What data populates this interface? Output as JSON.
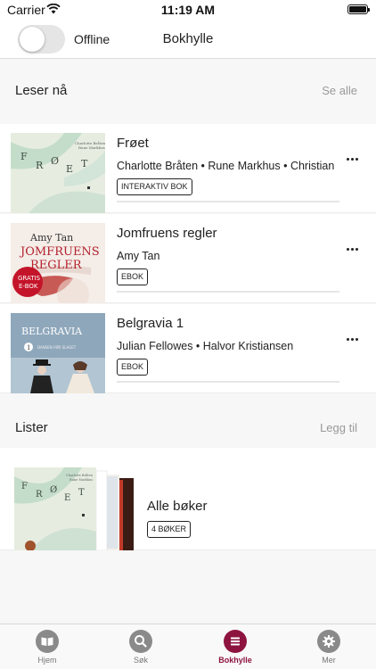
{
  "status": {
    "carrier": "Carrier",
    "time": "11:19 AM"
  },
  "nav": {
    "offline_label": "Offline",
    "title": "Bokhylle",
    "offline_enabled": false
  },
  "reading": {
    "title": "Leser nå",
    "action": "Se alle",
    "books": [
      {
        "title": "Frøet",
        "authors": "Charlotte Bråten • Rune Markhus • Christian",
        "badge": "INTERAKTIV BOK",
        "cover_text": "FRØET",
        "cover_small": "Charlotte Bråten\nRune Markhus"
      },
      {
        "title": "Jomfruens regler",
        "authors": "Amy Tan",
        "badge": "EBOK",
        "cover_author": "Amy Tan",
        "cover_title_1": "JOMFRUENS",
        "cover_title_2": "REGLER",
        "cover_sticker_1": "GRATIS",
        "cover_sticker_2": "E-BOK"
      },
      {
        "title": "Belgravia 1",
        "authors": "Julian Fellowes • Halvor Kristiansen",
        "badge": "EBOK",
        "cover_title": "BELGRAVIA",
        "cover_sub": "DANSEN FØR SLAGET",
        "cover_num": "1"
      }
    ]
  },
  "lists": {
    "title": "Lister",
    "action": "Legg til",
    "items": [
      {
        "title": "Alle bøker",
        "badge": "4 BØKER",
        "cover_text": "FRØET"
      }
    ]
  },
  "tabs": [
    {
      "label": "Hjem",
      "icon": "book-icon",
      "active": false
    },
    {
      "label": "Søk",
      "icon": "search-icon",
      "active": false
    },
    {
      "label": "Bokhylle",
      "icon": "bookshelf-icon",
      "active": true
    },
    {
      "label": "Mer",
      "icon": "gear-icon",
      "active": false
    }
  ],
  "colors": {
    "accent": "#8e1440",
    "inactive": "#8a8a8a",
    "background": "#f7f7f7"
  }
}
